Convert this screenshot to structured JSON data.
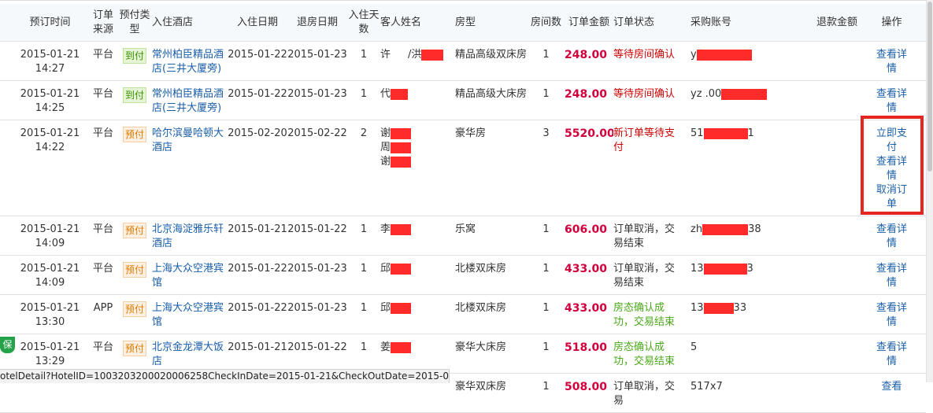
{
  "header": {
    "booking_time": "预订时间",
    "order_source": "订单来源",
    "booking_type": "预付类型",
    "hotel": "入住酒店",
    "checkin_date": "入住日期",
    "checkout_date": "退房日期",
    "nights": "入住天数",
    "guest_name": "客人姓名",
    "room_type": "房型",
    "room_count": "房间数",
    "order_amount": "订单金额",
    "order_status": "订单状态",
    "purchase_account": "采购账号",
    "refund_amount": "退款金额",
    "actions": "操作"
  },
  "rows": [
    {
      "date": "2015-01-21",
      "time": "14:27",
      "source": "平台",
      "type": "到付",
      "hotel": "常州柏臣精品酒店(三井大厦旁)",
      "checkin": "2015-01-22",
      "checkout": "2015-01-23",
      "nights": "1",
      "guest": [
        "许",
        "/洪"
      ],
      "room": "精品高级双床房",
      "rooms": "1",
      "amount": "248.00",
      "status": "等待房间确认",
      "account": "y",
      "refund": "",
      "actions": [
        "查看详情"
      ]
    },
    {
      "date": "2015-01-21",
      "time": "14:25",
      "source": "平台",
      "type": "到付",
      "hotel": "常州柏臣精品酒店(三井大厦旁)",
      "checkin": "2015-01-22",
      "checkout": "2015-01-23",
      "nights": "1",
      "guest": [
        "代"
      ],
      "room": "精品高级大床房",
      "rooms": "1",
      "amount": "248.00",
      "status": "等待房间确认",
      "account": "yz   .00",
      "refund": "",
      "actions": [
        "查看详情"
      ]
    },
    {
      "date": "2015-01-21",
      "time": "14:22",
      "source": "平台",
      "type": "预付",
      "hotel": "哈尔滨曼哈顿大酒店",
      "checkin": "2015-02-20",
      "checkout": "2015-02-22",
      "nights": "2",
      "guest": [
        "谢",
        "周",
        "谢"
      ],
      "room": "豪华房",
      "rooms": "3",
      "amount": "5520.00",
      "status": "新订单等待支付",
      "account": "51",
      "account_tail": "1",
      "refund": "",
      "actions": [
        "立即支付",
        "查看详情",
        "取消订单"
      ]
    },
    {
      "date": "2015-01-21",
      "time": "14:09",
      "source": "平台",
      "type": "预付",
      "hotel": "北京海淀雅乐轩酒店",
      "checkin": "2015-01-21",
      "checkout": "2015-01-22",
      "nights": "1",
      "guest": [
        "李"
      ],
      "room": "乐窝",
      "rooms": "1",
      "amount": "606.00",
      "status": "订单取消，交易结束",
      "account": "zh",
      "account_tail": "38",
      "refund": "",
      "actions": [
        "查看详情"
      ]
    },
    {
      "date": "2015-01-21",
      "time": "14:09",
      "source": "平台",
      "type": "预付",
      "hotel": "上海大众空港宾馆",
      "checkin": "2015-01-22",
      "checkout": "2015-01-23",
      "nights": "1",
      "guest": [
        "邱"
      ],
      "room": "北楼双床房",
      "rooms": "1",
      "amount": "433.00",
      "status": "订单取消，交易结束",
      "account": "13",
      "account_tail": "3",
      "refund": "",
      "actions": [
        "查看详情"
      ]
    },
    {
      "date": "2015-01-21",
      "time": "13:30",
      "source": "APP",
      "type": "预付",
      "hotel": "上海大众空港宾馆",
      "checkin": "2015-01-22",
      "checkout": "2015-01-23",
      "nights": "1",
      "guest": [
        "邱"
      ],
      "room": "北楼双床房",
      "rooms": "1",
      "amount": "433.00",
      "status": "房态确认成功，交易结束",
      "account": "13",
      "account_tail": "33",
      "refund": "",
      "actions": [
        "查看详情"
      ]
    },
    {
      "date": "2015-01-21",
      "time": "13:29",
      "source": "平台",
      "type": "预付",
      "hotel": "北京金龙潭大饭店",
      "checkin": "2015-01-21",
      "checkout": "2015-01-22",
      "nights": "1",
      "guest": [
        "姜"
      ],
      "room": "豪华大床房",
      "rooms": "1",
      "amount": "518.00",
      "status": "房态确认成功，交易结束",
      "account": "5",
      "refund": "",
      "actions": [
        "查看详情"
      ]
    },
    {
      "date": "",
      "time": "",
      "source": "",
      "type": "",
      "hotel": "",
      "checkin": "",
      "checkout": "",
      "nights": "",
      "guest": [],
      "room": "豪华双床房",
      "rooms": "1",
      "amount": "508.00",
      "status": "订单取消，交易",
      "account": "517x7",
      "refund": "",
      "actions": [
        "查看"
      ]
    }
  ],
  "bao_label": "保",
  "status_url": "otelDetail?HotelID=1003203200020006258CheckInDate=2015-01-21&CheckOutDate=2015-01-22",
  "colors": {
    "link": "#1a5ea8",
    "amount": "#d1003c",
    "status_red": "#cc0000",
    "status_green": "#4aa818",
    "highlight": "#e5251f"
  }
}
